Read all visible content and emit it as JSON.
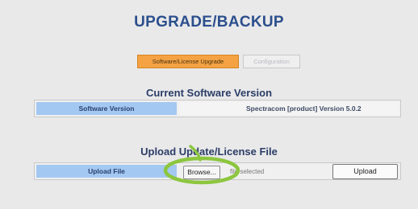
{
  "page": {
    "title": "UPGRADE/BACKUP"
  },
  "tabs": [
    {
      "label": "Software/License Upgrade",
      "active": true
    },
    {
      "label": "Configuration",
      "active": false
    }
  ],
  "software": {
    "section_title": "Current Software Version",
    "label": "Software Version",
    "value": "Spectracom [product] Version 5.0.2"
  },
  "upload": {
    "section_title": "Upload Update/License File",
    "label": "Upload File",
    "browse_label": "Browse...",
    "file_status": "file selected",
    "upload_label": "Upload"
  },
  "colors": {
    "accent_tab": "#f4a243",
    "label_cell": "#a3c8f2",
    "title": "#2b4f8c",
    "highlight_ring": "#8cc63f"
  }
}
